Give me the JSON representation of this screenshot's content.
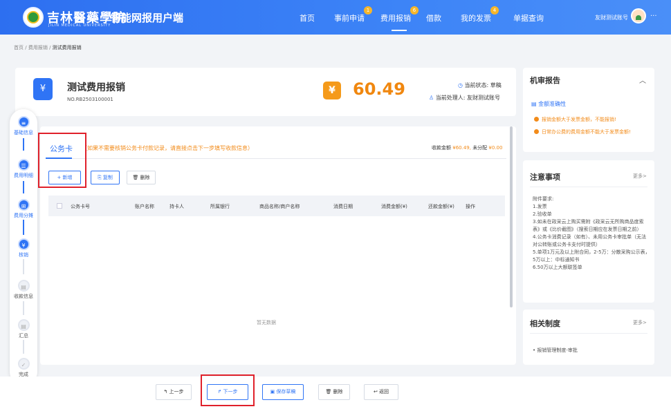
{
  "header": {
    "school_cn": "吉林醫藥學院",
    "school_en": "JILIN MEDICAL UNIVERSITY",
    "app_title": "智能网报用户端",
    "nav": [
      {
        "label": "首页",
        "badge": ""
      },
      {
        "label": "事前申请",
        "badge": "1"
      },
      {
        "label": "费用报销",
        "badge": "6"
      },
      {
        "label": "借款",
        "badge": ""
      },
      {
        "label": "我的发票",
        "badge": "4"
      },
      {
        "label": "单据查询",
        "badge": ""
      }
    ],
    "user": "友财测试账号",
    "more": "···"
  },
  "breadcrumb": {
    "home": "首页",
    "sep1": "/",
    "section": "费用报销",
    "sep2": "/",
    "current": "测试费用报销"
  },
  "doc": {
    "title": "测试费用报销",
    "number": "NO.RB2503100001",
    "amount": "60.49",
    "status_label": "当前状态:",
    "status_value": "草稿",
    "handler_label": "当前处理人:",
    "handler_value": "友财测试账号"
  },
  "steps": [
    {
      "label": "基础信息"
    },
    {
      "label": "费用明细"
    },
    {
      "label": "费用分摊"
    },
    {
      "label": "核销"
    },
    {
      "label": "收款信息"
    },
    {
      "label": "汇总"
    },
    {
      "label": "完成"
    }
  ],
  "section": {
    "tab": "公务卡",
    "hint": "（如果不需要核销公务卡付款记录，请直接点击下一步填写收款信息）",
    "sum_label": "收款金额",
    "sum_value": "¥60.49,",
    "unalloc_label": "未分配",
    "unalloc_value": "¥0.00",
    "buttons": {
      "add": "+ 新增",
      "copy": "复制",
      "delete": "删除"
    },
    "columns": [
      "公务卡号",
      "账户名称",
      "持卡人",
      "所属银行",
      "商品名称/商户名称",
      "消费日期",
      "消费金额(¥)",
      "还款金额(¥)",
      "操作"
    ],
    "empty_text": "暂无数据"
  },
  "audit": {
    "title": "机审报告",
    "collapse": "︿",
    "check_title": "金额准确性",
    "warnings": [
      "报销金额大于发票金额，不能报销!",
      "日常办公费的费用金额不能大于发票金额!"
    ]
  },
  "notice": {
    "title": "注意事项",
    "more": "更多>",
    "lines": [
      "附件要求:",
      "1.发票",
      "2.验收单",
      "3.如未在政采云上购买需附《政采云无所购商品度索表》或《比价截图》（搜索日期应在发票日期之前）",
      "4.公务卡消费记录（如有）、未用公务卡审批单（无法对公转账或公务卡支付时提供）",
      "5.单项1万元及以上附合同，2-5万：分散采购公示表，5万以上：中标通知书",
      "6.50万以上大额联签单"
    ]
  },
  "rules": {
    "title": "相关制度",
    "more": "更多>",
    "items": [
      "报销管理制度-审批"
    ]
  },
  "footer": {
    "prev": "上一步",
    "next": "下一步",
    "save": "保存草稿",
    "delete": "删除",
    "back": "返回"
  }
}
